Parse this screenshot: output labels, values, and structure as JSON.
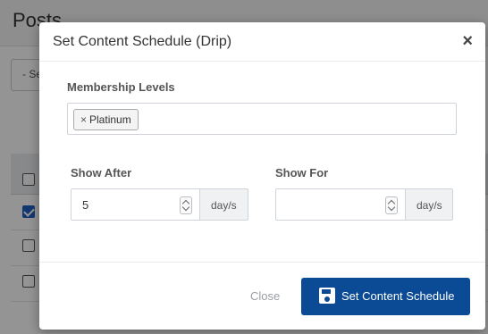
{
  "background": {
    "page_title": "Posts",
    "filter_placeholder": "- Se"
  },
  "modal": {
    "title": "Set Content Schedule (Drip)",
    "close_symbol": "×",
    "membership": {
      "label": "Membership Levels",
      "tags": [
        {
          "remove_symbol": "×",
          "label": "Platinum"
        }
      ]
    },
    "show_after": {
      "label": "Show After",
      "value": "5",
      "unit": "day/s"
    },
    "show_for": {
      "label": "Show For",
      "value": "",
      "unit": "day/s"
    },
    "footer": {
      "close_label": "Close",
      "submit_label": "Set Content Schedule",
      "submit_icon": "save-icon"
    }
  },
  "colors": {
    "primary": "#0b4a94",
    "overlay": "rgba(0,0,0,0.42)"
  }
}
